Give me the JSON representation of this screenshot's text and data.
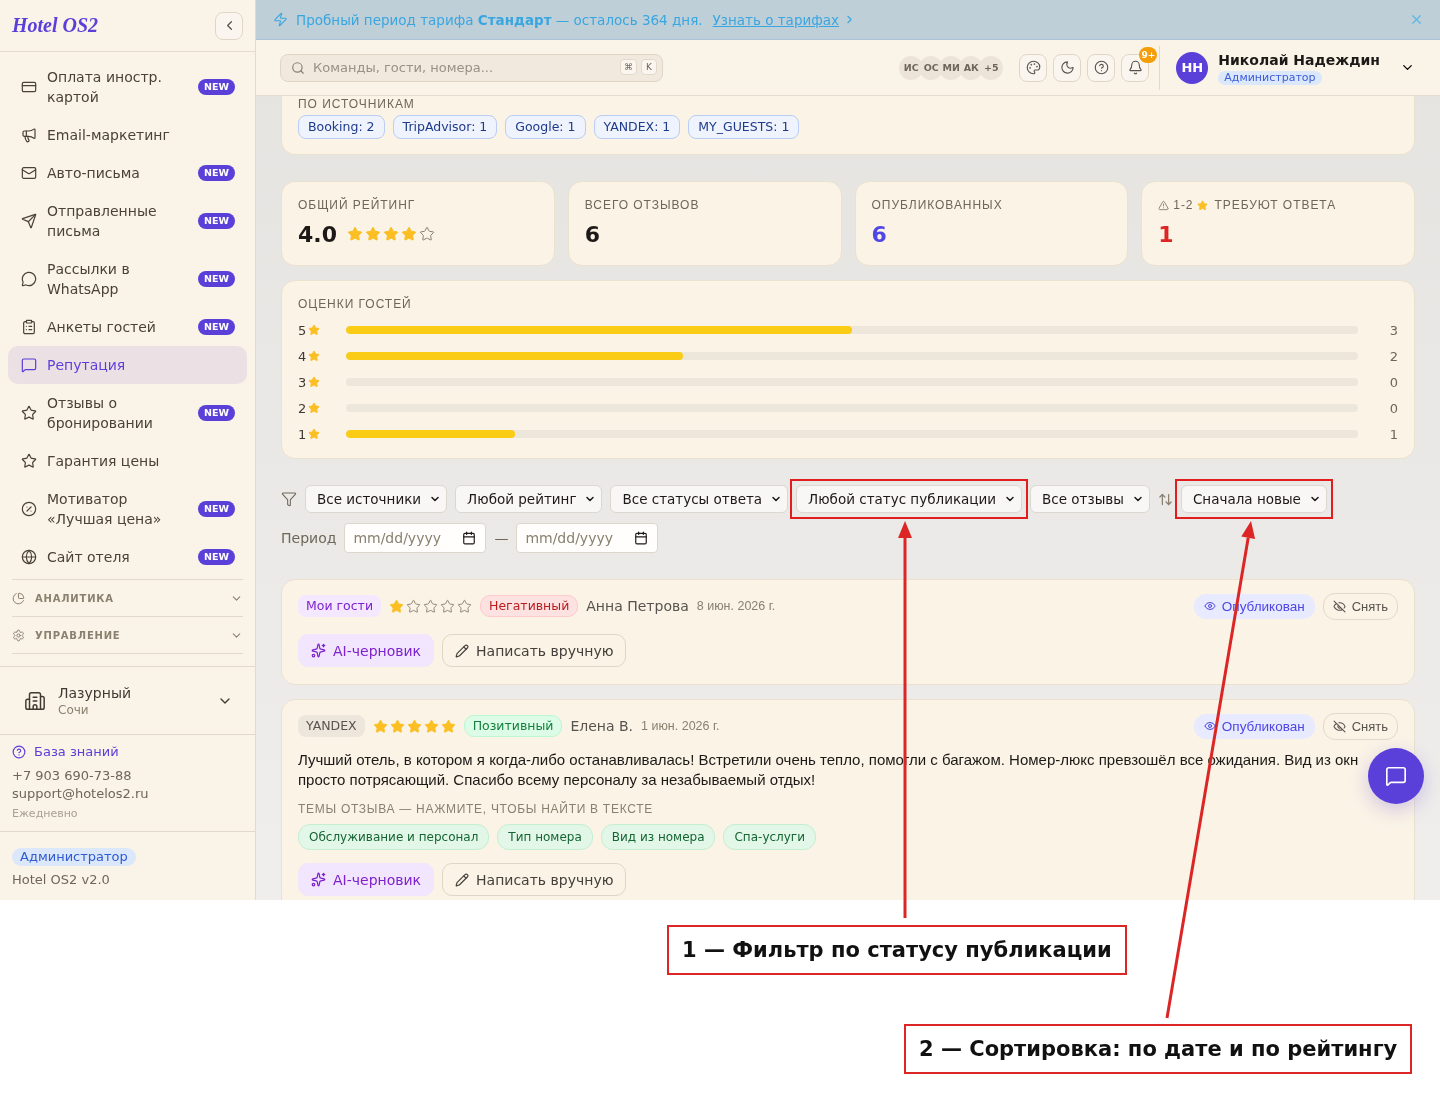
{
  "sidebar": {
    "logo": "Hotel OS2",
    "items": [
      {
        "label": "Оплата иностр. картой",
        "badge": "NEW",
        "selected": false
      },
      {
        "label": "Email-маркетинг",
        "selected": false
      },
      {
        "label": "Авто-письма",
        "badge": "NEW",
        "selected": false
      },
      {
        "label": "Отправленные письма",
        "badge": "NEW",
        "selected": false
      },
      {
        "label": "Рассылки в WhatsApp",
        "badge": "NEW",
        "selected": false
      },
      {
        "label": "Анкеты гостей",
        "badge": "NEW",
        "selected": false
      },
      {
        "label": "Репутация",
        "selected": true
      },
      {
        "label": "Отзывы о бронировании",
        "badge": "NEW",
        "selected": false
      },
      {
        "label": "Гарантия цены",
        "selected": false
      },
      {
        "label": "Мотиватор «Лучшая цена»",
        "badge": "NEW",
        "selected": false
      },
      {
        "label": "Сайт отеля",
        "badge": "NEW",
        "selected": false
      }
    ],
    "sections": [
      {
        "label": "АНАЛИТИКА",
        "expanded": false
      },
      {
        "label": "УПРАВЛЕНИЕ",
        "expanded": false
      }
    ],
    "hotel": {
      "name": "Лазурный",
      "city": "Сочи"
    },
    "support": {
      "link": "База знаний",
      "phone": "+7 903 690-73-88",
      "email": "support@hotelos2.ru",
      "hours": "Ежедневно"
    },
    "role": "Администратор",
    "version": "Hotel OS2 v2.0"
  },
  "banner": {
    "text": "Пробный период тарифа **Стандарт** — осталось 364 дня.",
    "link": "Узнать о тарифах"
  },
  "header": {
    "search": {
      "placeholder": "Команды, гости, номера...",
      "keys": [
        "⌘",
        "K"
      ]
    },
    "online_users": [
      "ИС",
      "ОС",
      "МИ",
      "АК"
    ],
    "online_more": "+5",
    "notifications": "9+",
    "user": {
      "initials": "НН",
      "name": "Николай Надеждин",
      "role": "Администратор"
    }
  },
  "sources": {
    "title": "ПО ИСТОЧНИКАМ",
    "chips": [
      "Booking: 2",
      "TripAdvisor: 1",
      "Google: 1",
      "YANDEX: 1",
      "MY_GUESTS: 1"
    ]
  },
  "stats": [
    {
      "kind": "rating",
      "label": "ОБЩИЙ РЕЙТИНГ",
      "value": "4.0",
      "stars": 4
    },
    {
      "kind": "plain",
      "label": "ВСЕГО ОТЗЫВОВ",
      "value": "6"
    },
    {
      "kind": "accent",
      "label": "ОПУБЛИКОВАННЫХ",
      "value": "6"
    },
    {
      "kind": "alert",
      "range": "1-2",
      "label": "ТРЕБУЮТ ОТВЕТА",
      "value": "1"
    }
  ],
  "ratings": {
    "title": "ОЦЕНКИ ГОСТЕЙ",
    "rows": [
      {
        "score": "5",
        "level": 0.5,
        "count": "3"
      },
      {
        "score": "4",
        "level": 0.333,
        "count": "2"
      },
      {
        "score": "3",
        "level": 0,
        "count": "0"
      },
      {
        "score": "2",
        "level": 0,
        "count": "0"
      },
      {
        "score": "1",
        "level": 0.167,
        "count": "1"
      }
    ]
  },
  "filters": {
    "selects": [
      {
        "value": "Все источники",
        "highlighted": false
      },
      {
        "value": "Любой рейтинг",
        "highlighted": false
      },
      {
        "value": "Все статусы ответа",
        "highlighted": false
      },
      {
        "value": "Любой статус публикации",
        "highlighted": true
      },
      {
        "value": "Все отзывы",
        "highlighted": false
      }
    ],
    "sort": {
      "value": "Сначала новые",
      "highlighted": true
    },
    "period": {
      "label": "Период",
      "from_placeholder": "mm/dd/yyyy",
      "separator": "—",
      "to_placeholder": "mm/dd/yyyy"
    }
  },
  "reviews": [
    {
      "source": {
        "label": "Мои гости",
        "kind": "own"
      },
      "stars": 1,
      "sentiment": {
        "label": "Негативный",
        "kind": "negative"
      },
      "author": "Анна Петрова",
      "date": "8 июн. 2026 г.",
      "status": {
        "label": "Опубликован",
        "kind": "published"
      },
      "unpublish": "Снять",
      "actions": [
        {
          "label": "AI-черновик",
          "kind": "ai"
        },
        {
          "label": "Написать вручную",
          "kind": "manual"
        }
      ]
    },
    {
      "source": {
        "label": "YANDEX",
        "kind": "external"
      },
      "stars": 5,
      "sentiment": {
        "label": "Позитивный",
        "kind": "positive"
      },
      "author": "Елена В.",
      "date": "1 июн. 2026 г.",
      "status": {
        "label": "Опубликован",
        "kind": "published"
      },
      "unpublish": "Снять",
      "text_lines": [
        "Лучший отель, в котором я когда-либо останавливалась! Встретили очень тепло, помогли с багажом. Номер-люкс превзошёл все ожидания. Вид из окн",
        "просто потрясающий. Спасибо всему персоналу за незабываемый отдых!"
      ],
      "topics_title": "ТЕМЫ ОТЗЫВА — НАЖМИТЕ, ЧТОБЫ НАЙТИ В ТЕКСТЕ",
      "topics": [
        "Обслуживание и персонал",
        "Тип номера",
        "Вид из номера",
        "Спа-услуги"
      ],
      "actions": [
        {
          "label": "AI-черновик",
          "kind": "ai"
        },
        {
          "label": "Написать вручную",
          "kind": "manual"
        }
      ]
    }
  ],
  "annotations": [
    {
      "text": "1 — Фильтр по статусу публикации"
    },
    {
      "text": "2 — Сортировка: по дате и по рейтингу"
    }
  ]
}
